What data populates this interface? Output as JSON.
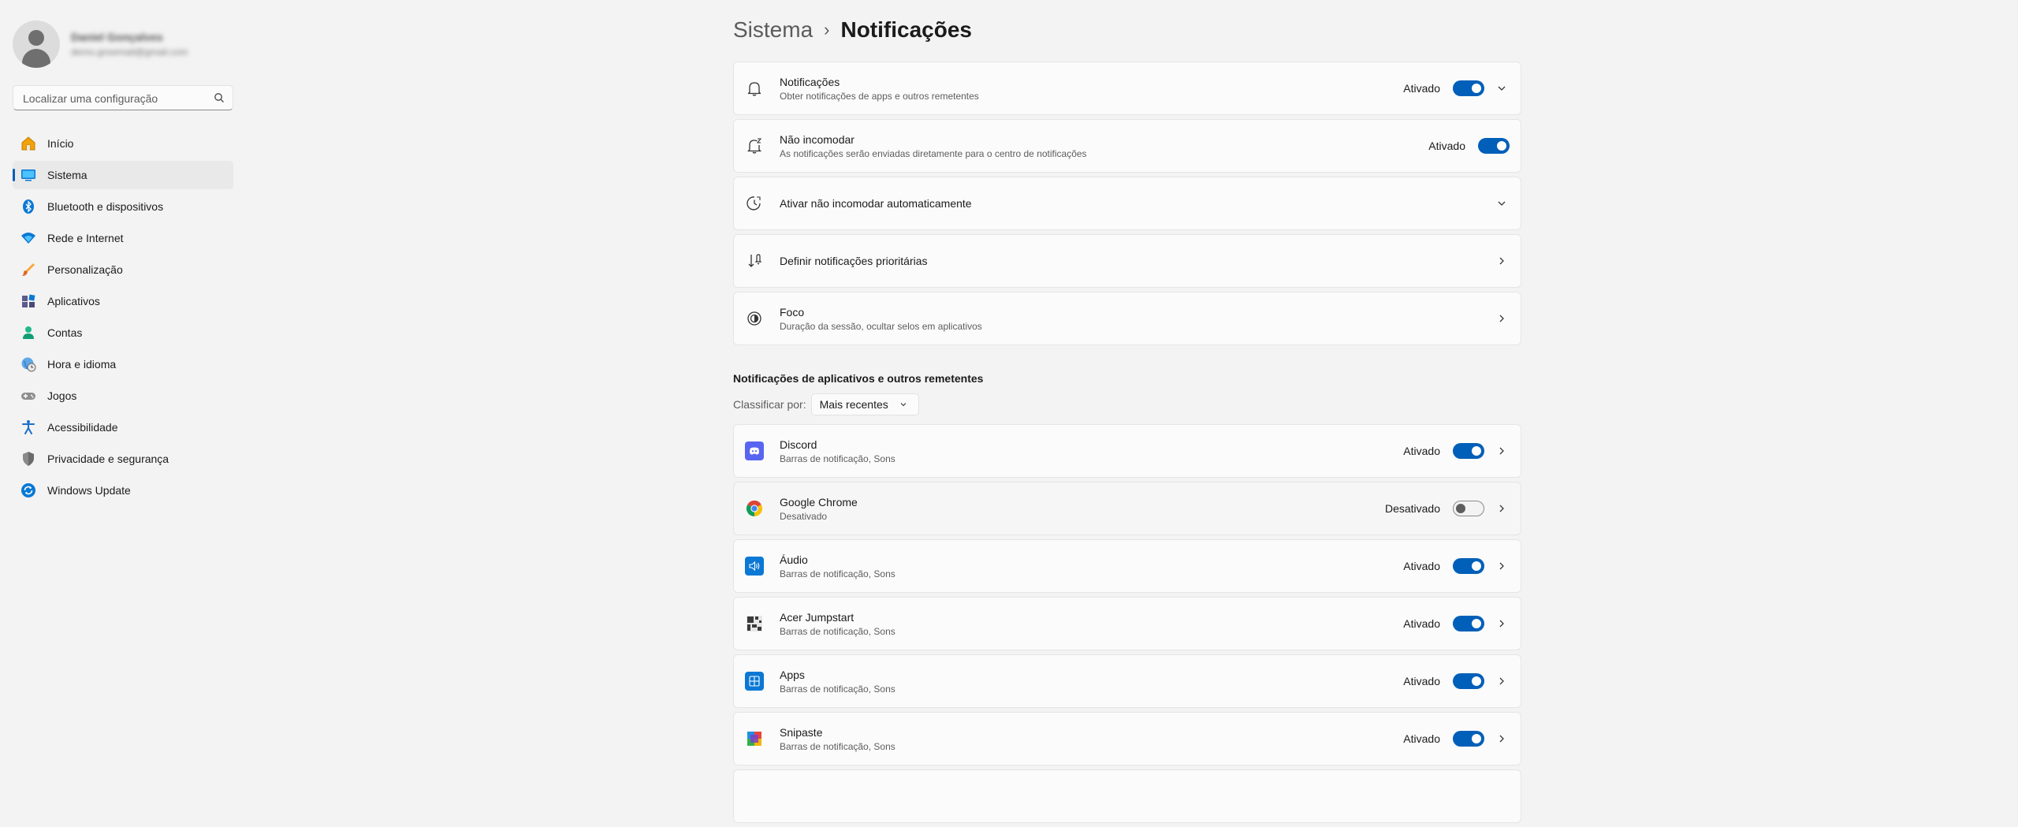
{
  "profile": {
    "name": "Daniel Gonçalves",
    "email": "demo.gnsemail@gmail.com"
  },
  "search": {
    "placeholder": "Localizar uma configuração"
  },
  "nav": [
    {
      "label": "Início",
      "icon": "home-icon"
    },
    {
      "label": "Sistema",
      "icon": "system-icon",
      "active": true
    },
    {
      "label": "Bluetooth e dispositivos",
      "icon": "bluetooth-icon"
    },
    {
      "label": "Rede e Internet",
      "icon": "wifi-icon"
    },
    {
      "label": "Personalização",
      "icon": "brush-icon"
    },
    {
      "label": "Aplicativos",
      "icon": "apps-icon"
    },
    {
      "label": "Contas",
      "icon": "account-icon"
    },
    {
      "label": "Hora e idioma",
      "icon": "globe-clock-icon"
    },
    {
      "label": "Jogos",
      "icon": "gamepad-icon"
    },
    {
      "label": "Acessibilidade",
      "icon": "accessibility-icon"
    },
    {
      "label": "Privacidade e segurança",
      "icon": "shield-icon"
    },
    {
      "label": "Windows Update",
      "icon": "update-icon"
    }
  ],
  "breadcrumb": {
    "parent": "Sistema",
    "separator": "›",
    "current": "Notificações"
  },
  "settings": [
    {
      "title": "Notificações",
      "subtitle": "Obter notificações de apps e outros remetentes",
      "status": "Ativado",
      "toggle": true,
      "chevron": "down",
      "icon": "bell-icon"
    },
    {
      "title": "Não incomodar",
      "subtitle": "As notificações serão enviadas diretamente para o centro de notificações",
      "status": "Ativado",
      "toggle": true,
      "chevron": "none",
      "icon": "bell-snooze-icon"
    },
    {
      "title": "Ativar não incomodar automaticamente",
      "subtitle": "",
      "status": "",
      "toggle": null,
      "chevron": "down",
      "icon": "clock-icon"
    },
    {
      "title": "Definir notificações prioritárias",
      "subtitle": "",
      "status": "",
      "toggle": null,
      "chevron": "right",
      "icon": "priority-icon"
    },
    {
      "title": "Foco",
      "subtitle": "Duração da sessão, ocultar selos em aplicativos",
      "status": "",
      "toggle": null,
      "chevron": "right",
      "icon": "focus-icon"
    }
  ],
  "apps_section": {
    "title": "Notificações de aplicativos e outros remetentes",
    "sort_label": "Classificar por:",
    "sort_value": "Mais recentes"
  },
  "apps": [
    {
      "name": "Discord",
      "subtitle": "Barras de notificação, Sons",
      "status": "Ativado",
      "on": true,
      "icon": "discord-icon",
      "color": "#5865f2"
    },
    {
      "name": "Google Chrome",
      "subtitle": "Desativado",
      "status": "Desativado",
      "on": false,
      "icon": "chrome-icon",
      "color": "#db4437"
    },
    {
      "name": "Áudio",
      "subtitle": "Barras de notificação, Sons",
      "status": "Ativado",
      "on": true,
      "icon": "speaker-icon",
      "color": "#0a78d4"
    },
    {
      "name": "Acer Jumpstart",
      "subtitle": "Barras de notificação, Sons",
      "status": "Ativado",
      "on": true,
      "icon": "acer-jumpstart-icon",
      "color": "#2b2b2b"
    },
    {
      "name": "Apps",
      "subtitle": "Barras de notificação, Sons",
      "status": "Ativado",
      "on": true,
      "icon": "apps-tile-icon",
      "color": "#0a78d4"
    },
    {
      "name": "Snipaste",
      "subtitle": "Barras de notificação, Sons",
      "status": "Ativado",
      "on": true,
      "icon": "snipaste-icon",
      "color": "#1f8fe0"
    }
  ],
  "colors": {
    "accent": "#005fb8",
    "background": "#f3f3f3",
    "card": "#fbfbfb"
  }
}
